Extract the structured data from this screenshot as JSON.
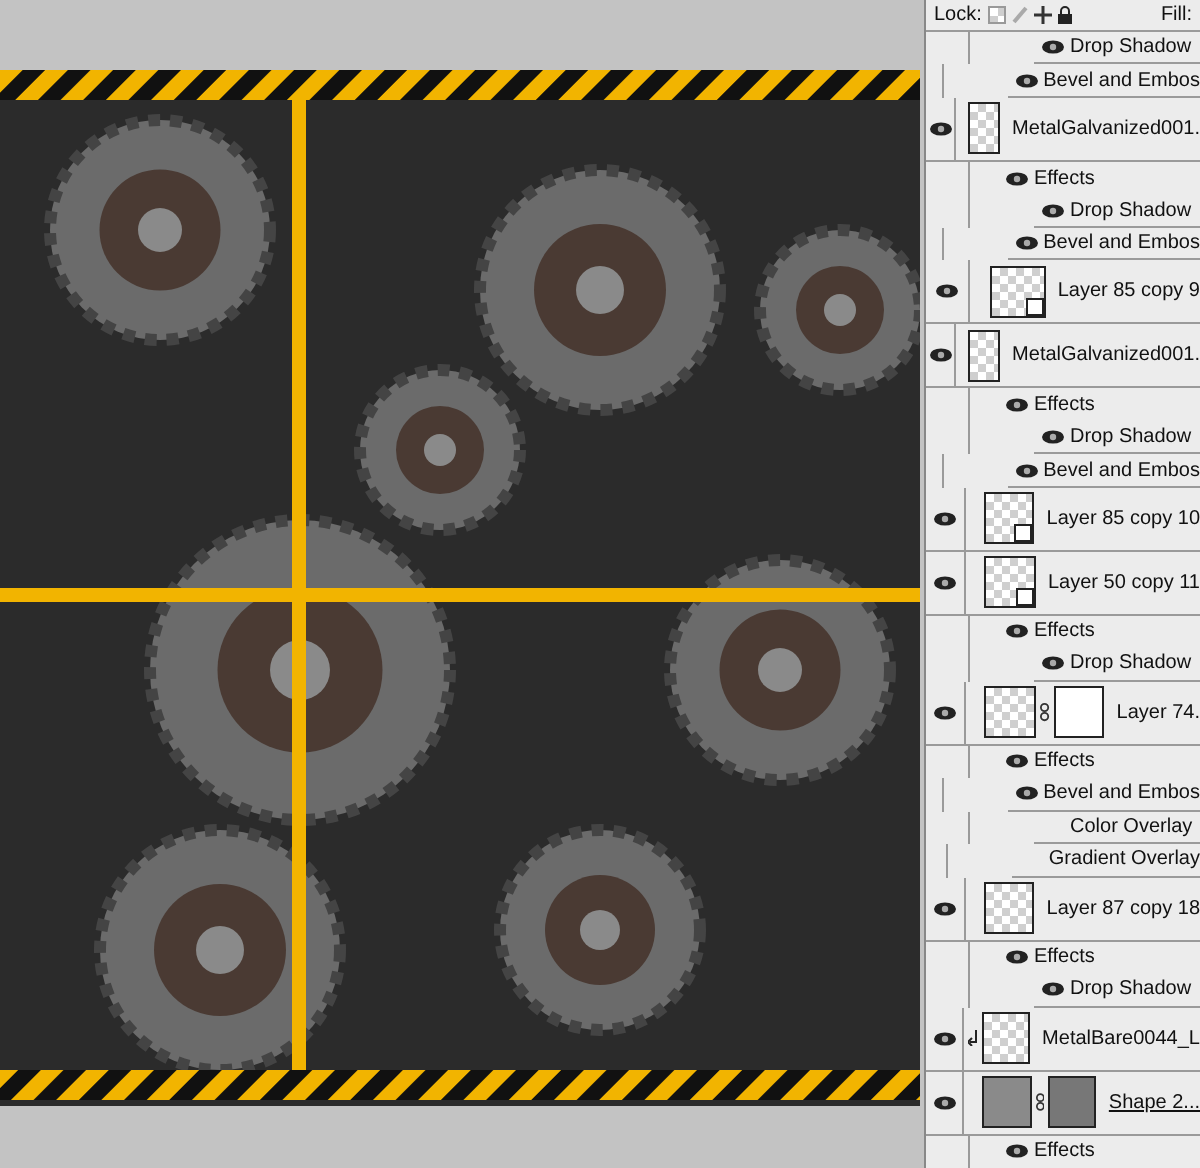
{
  "lock_bar": {
    "label": "Lock:",
    "fill_label": "Fill:"
  },
  "rows": [
    {
      "kind": "effect",
      "label": "Drop Shadow",
      "visible": true
    },
    {
      "kind": "effect",
      "label": "Bevel and Embos",
      "visible": true
    },
    {
      "kind": "layer",
      "label": "MetalGalvanized001.",
      "visible": true,
      "smart_object": false,
      "mask": false,
      "clipped": false,
      "shape": false
    },
    {
      "kind": "effects",
      "label": "Effects",
      "visible": true
    },
    {
      "kind": "effect",
      "label": "Drop Shadow",
      "visible": true
    },
    {
      "kind": "effect",
      "label": "Bevel and Embos",
      "visible": true
    },
    {
      "kind": "layer",
      "label": "Layer 85 copy 9",
      "visible": true,
      "smart_object": true,
      "mask": false,
      "clipped": false,
      "shape": false
    },
    {
      "kind": "layer",
      "label": "MetalGalvanized001.",
      "visible": true,
      "smart_object": false,
      "mask": false,
      "clipped": false,
      "shape": false
    },
    {
      "kind": "effects",
      "label": "Effects",
      "visible": true
    },
    {
      "kind": "effect",
      "label": "Drop Shadow",
      "visible": true
    },
    {
      "kind": "effect",
      "label": "Bevel and Embos",
      "visible": true
    },
    {
      "kind": "layer",
      "label": "Layer 85 copy 10",
      "visible": true,
      "smart_object": true,
      "mask": false,
      "clipped": false,
      "shape": false
    },
    {
      "kind": "layer",
      "label": "Layer 50 copy 11",
      "visible": true,
      "smart_object": true,
      "mask": false,
      "clipped": false,
      "shape": false
    },
    {
      "kind": "effects",
      "label": "Effects",
      "visible": true
    },
    {
      "kind": "effect",
      "label": "Drop Shadow",
      "visible": true
    },
    {
      "kind": "layer",
      "label": "Layer 74.",
      "visible": true,
      "smart_object": false,
      "mask": true,
      "clipped": false,
      "shape": false
    },
    {
      "kind": "effects",
      "label": "Effects",
      "visible": true
    },
    {
      "kind": "effect",
      "label": "Bevel and Embos",
      "visible": true
    },
    {
      "kind": "effect",
      "label": "Color Overlay",
      "visible": false
    },
    {
      "kind": "effect",
      "label": "Gradient Overlay",
      "visible": false
    },
    {
      "kind": "layer",
      "label": "Layer 87 copy 18",
      "visible": true,
      "smart_object": false,
      "mask": false,
      "clipped": false,
      "shape": false
    },
    {
      "kind": "effects",
      "label": "Effects",
      "visible": true
    },
    {
      "kind": "effect",
      "label": "Drop Shadow",
      "visible": true
    },
    {
      "kind": "layer",
      "label": "MetalBare0044_L",
      "visible": true,
      "smart_object": false,
      "mask": false,
      "clipped": true,
      "shape": false
    },
    {
      "kind": "layer",
      "label": "Shape 2...",
      "visible": true,
      "smart_object": false,
      "mask": true,
      "clipped": false,
      "shape": true
    },
    {
      "kind": "effects",
      "label": "Effects",
      "visible": true
    }
  ]
}
